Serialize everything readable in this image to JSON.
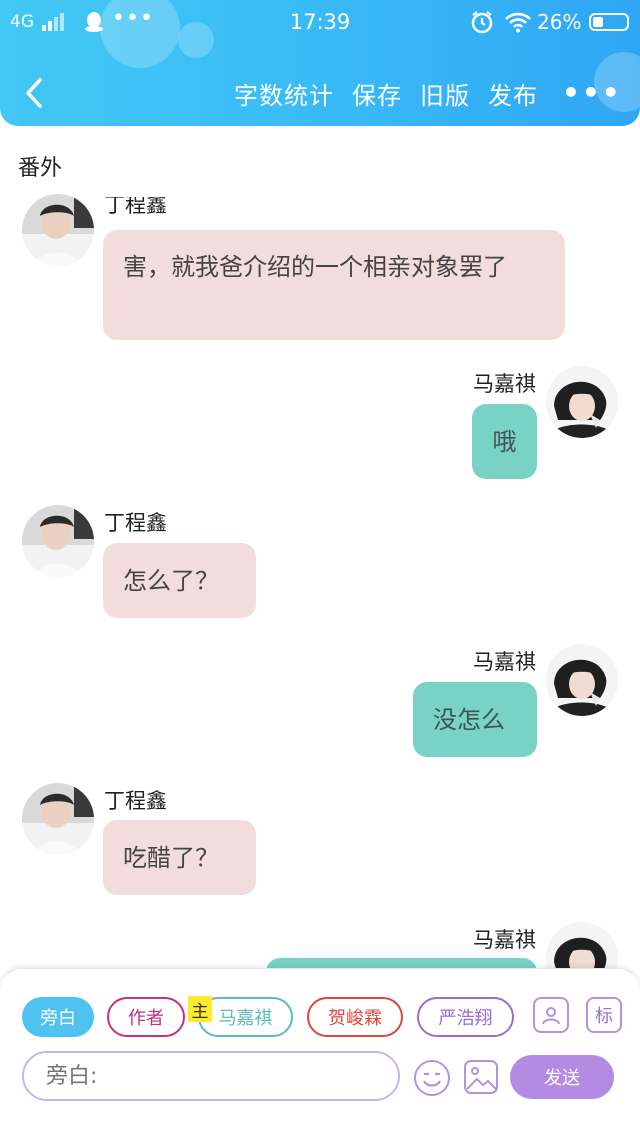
{
  "status_bar": {
    "network": "4G",
    "time": "17:39",
    "battery": "26%",
    "battery_level": 0.26,
    "notification_icons": [
      "qq-icon",
      "more-dots-icon"
    ],
    "right_icons": [
      "alarm-icon",
      "wifi-icon",
      "battery-icon"
    ]
  },
  "nav": {
    "back_icon": "back-arrow-icon",
    "items": [
      "字数统计",
      "保存",
      "旧版",
      "发布"
    ],
    "more_icon": "more-icon"
  },
  "subtitle": "番外",
  "messages": [
    {
      "side": "left",
      "name": "丁程鑫",
      "text": "害，就我爸介绍的一个相亲对象罢了",
      "partial_name": true
    },
    {
      "side": "right",
      "name": "马嘉祺",
      "text": "哦"
    },
    {
      "side": "left",
      "name": "丁程鑫",
      "text": "怎么了？"
    },
    {
      "side": "right",
      "name": "马嘉祺",
      "text": "没怎么"
    },
    {
      "side": "left",
      "name": "丁程鑫",
      "text": "吃醋了？"
    },
    {
      "side": "right",
      "name": "马嘉祺",
      "text": ""
    }
  ],
  "role_chips": [
    {
      "label": "旁白",
      "active": true,
      "color": "#4fc3f0"
    },
    {
      "label": "作者",
      "color": "#c2327f"
    },
    {
      "label": "马嘉祺",
      "color": "#5bbcc0",
      "tag": "主"
    },
    {
      "label": "贺峻霖",
      "color": "#d9473f"
    },
    {
      "label": "严浩翔",
      "color": "#9b6bd2"
    }
  ],
  "tools": {
    "role_icon": "person-card-icon",
    "mark_label": "标"
  },
  "composer": {
    "placeholder": "旁白:",
    "emoji_icon": "emoji-icon",
    "image_icon": "image-icon",
    "send_label": "发送"
  },
  "colors": {
    "header_gradient_start": "#42c8f4",
    "header_gradient_end": "#2fa6f4",
    "left_bubble": "#f3dcdc",
    "right_bubble": "#79d2c6",
    "send_button": "#b48be4"
  }
}
